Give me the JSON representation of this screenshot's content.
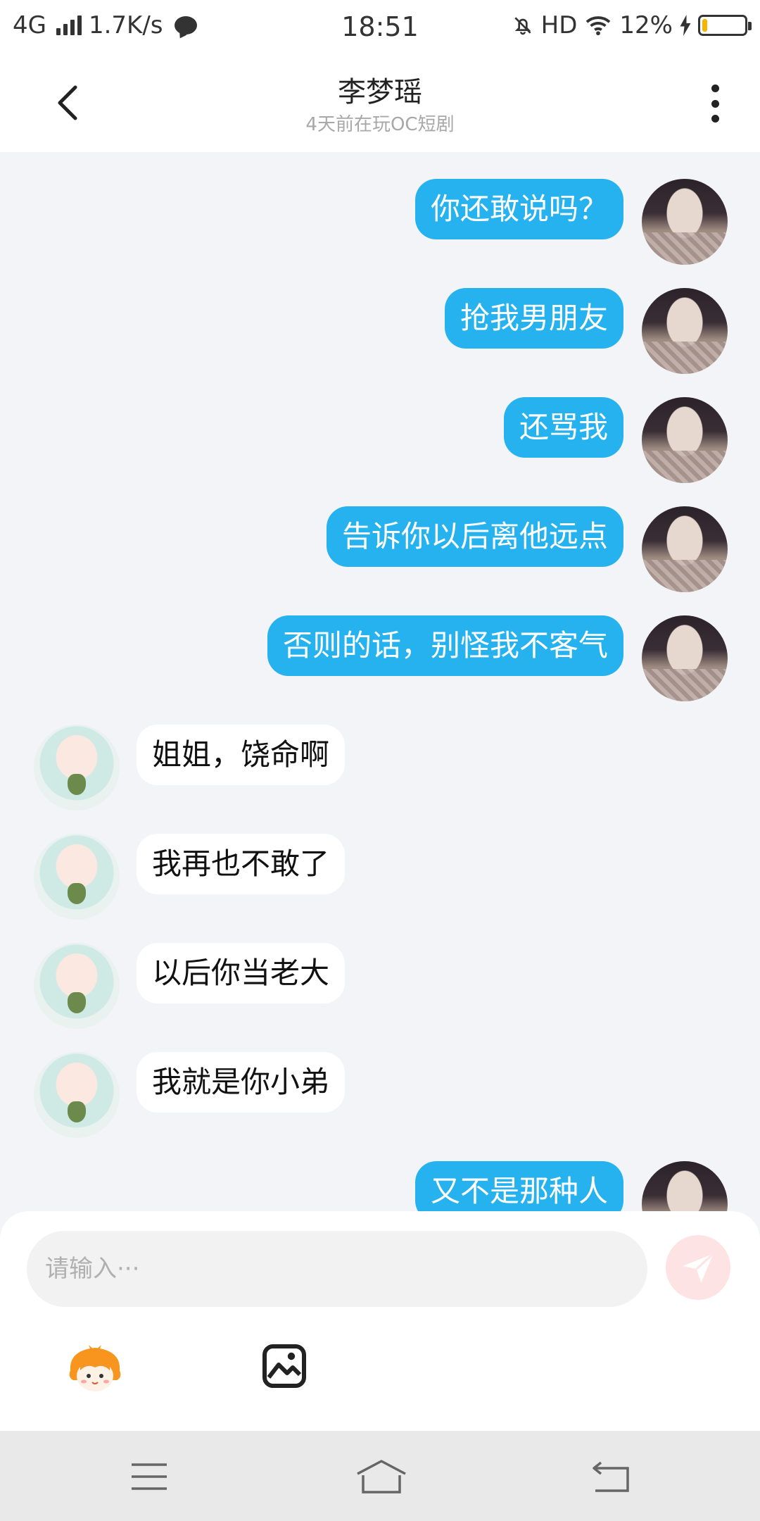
{
  "status_bar": {
    "network": "4G",
    "speed": "1.7K/s",
    "time": "18:51",
    "hd": "HD",
    "battery": "12%",
    "battery_level": 0.12
  },
  "header": {
    "title": "李梦瑶",
    "subtitle": "4天前在玩OC短剧"
  },
  "messages": [
    {
      "side": "out",
      "text": "你还敢说吗？"
    },
    {
      "side": "out",
      "text": "抢我男朋友"
    },
    {
      "side": "out",
      "text": "还骂我"
    },
    {
      "side": "out",
      "text": "告诉你以后离他远点"
    },
    {
      "side": "out",
      "text": "否则的话，别怪我不客气"
    },
    {
      "side": "in",
      "text": "姐姐，饶命啊"
    },
    {
      "side": "in",
      "text": "我再也不敢了"
    },
    {
      "side": "in",
      "text": "以后你当老大"
    },
    {
      "side": "in",
      "text": "我就是你小弟"
    },
    {
      "side": "out",
      "text": "又不是那种人"
    }
  ],
  "composer": {
    "placeholder": "请输入···"
  },
  "colors": {
    "accent": "#26b2ef",
    "send_button_disabled": "#fde3e4",
    "background": "#f3f4f8"
  },
  "icons": {
    "back": "chevron-left-icon",
    "more": "more-vertical-icon",
    "send": "paper-plane-icon",
    "emoji": "mascot-emoji-icon",
    "image": "image-icon",
    "nav_menu": "menu-icon",
    "nav_home": "home-icon",
    "nav_back": "return-icon"
  }
}
